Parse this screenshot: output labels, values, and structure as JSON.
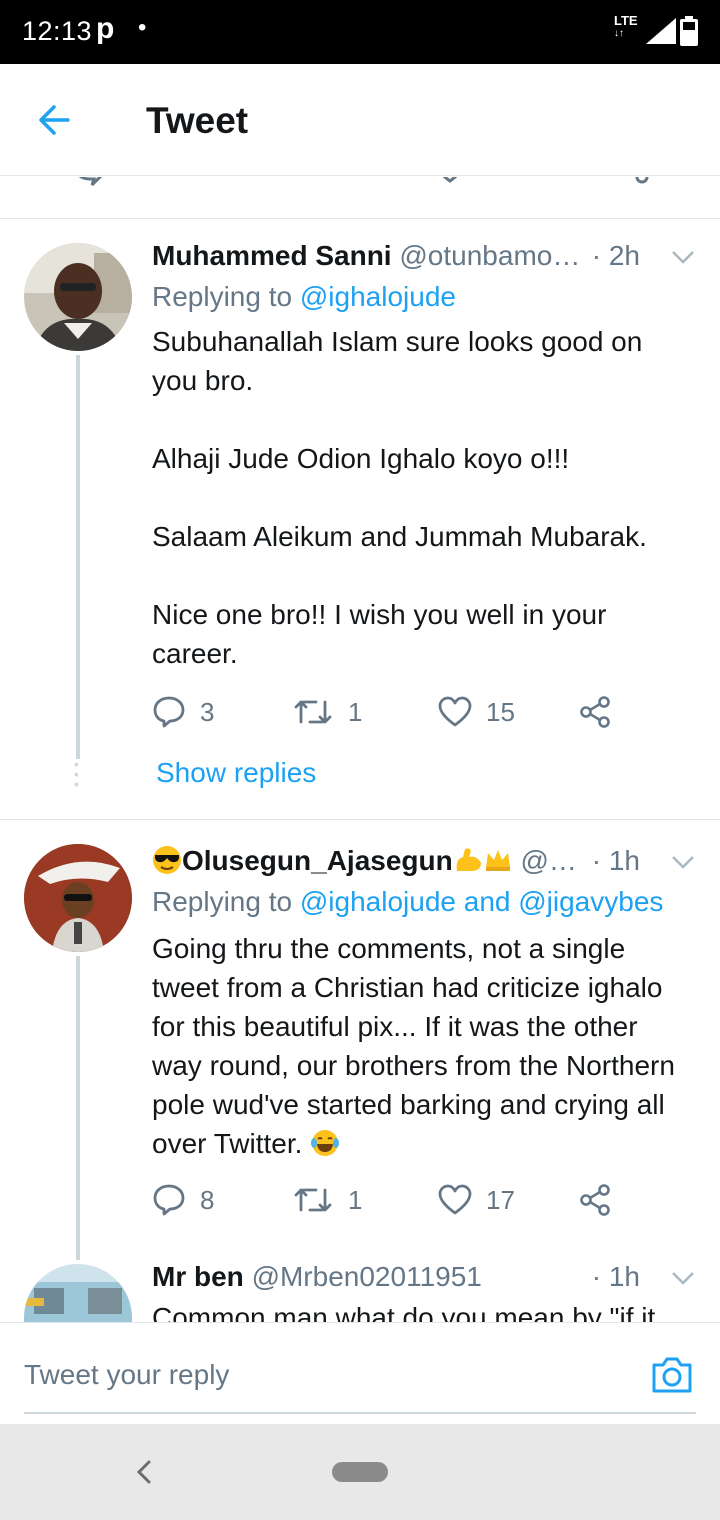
{
  "status_bar": {
    "time": "12:13",
    "app_glyph": "p",
    "dot": "•",
    "network": "LTE",
    "arrows": "↓↑"
  },
  "header": {
    "title": "Tweet",
    "back_icon": "arrow-left-icon"
  },
  "colors": {
    "accent": "#1da1f2",
    "secondary": "#657786",
    "text": "#14171a",
    "divider": "#e1e8ed"
  },
  "tweets": [
    {
      "name": "Muhammed Sanni",
      "handle": "@otunbamo…",
      "time": "· 2h",
      "replying_prefix": "Replying to ",
      "replying_to": "@ighalojude",
      "body": "Subuhanallah Islam sure looks good on you bro.\n\nAlhaji Jude Odion Ighalo koyo o!!!\n\nSalaam Aleikum and Jummah Mubarak.\n\nNice one bro!! I wish you well in your career.",
      "replies": "3",
      "retweets": "1",
      "likes": "15",
      "show_replies": "Show replies"
    },
    {
      "name": "Olusegun_Ajasegun",
      "name_emojis": [
        "sunglasses-emoji",
        "flexed-biceps-emoji",
        "crown-emoji"
      ],
      "handle": "@…",
      "time": "· 1h",
      "replying_prefix": "Replying to ",
      "replying_to": "@ighalojude and @jigavybes",
      "body": "Going thru the comments, not a single tweet from a Christian had criticize ighalo for this beautiful pix... If it was the other way round, our brothers from the Northern pole wud've started barking and crying all over Twitter. ",
      "body_emoji": "laughing-tears-emoji",
      "replies": "8",
      "retweets": "1",
      "likes": "17"
    },
    {
      "name": "Mr ben",
      "handle": "@Mrben02011951",
      "time": "· 1h",
      "body": "Common man what do you mean by \"if it"
    }
  ],
  "compose": {
    "placeholder": "Tweet your reply"
  }
}
